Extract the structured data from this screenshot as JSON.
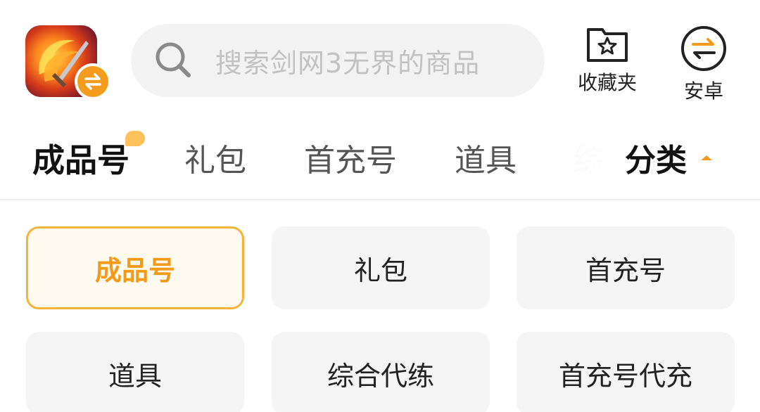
{
  "header": {
    "search": {
      "placeholder": "搜索剑网3无界的商品"
    },
    "favorites_label": "收藏夹",
    "android_label": "安卓"
  },
  "tabs": [
    {
      "label": "成品号",
      "active": true
    },
    {
      "label": "礼包"
    },
    {
      "label": "首充号"
    },
    {
      "label": "道具"
    },
    {
      "label": "综"
    }
  ],
  "category_label": "分类",
  "grid": [
    {
      "label": "成品号",
      "selected": true
    },
    {
      "label": "礼包"
    },
    {
      "label": "首充号"
    },
    {
      "label": "道具"
    },
    {
      "label": "综合代练"
    },
    {
      "label": "首充号代充"
    }
  ],
  "colors": {
    "accent": "#f39b1c",
    "selected_border": "#f5b33a",
    "selected_bg": "#fffaef"
  },
  "icons": [
    "app-icon",
    "swap-icon",
    "search-icon",
    "star-folder-icon",
    "android-swap-icon",
    "caret-up-icon"
  ]
}
